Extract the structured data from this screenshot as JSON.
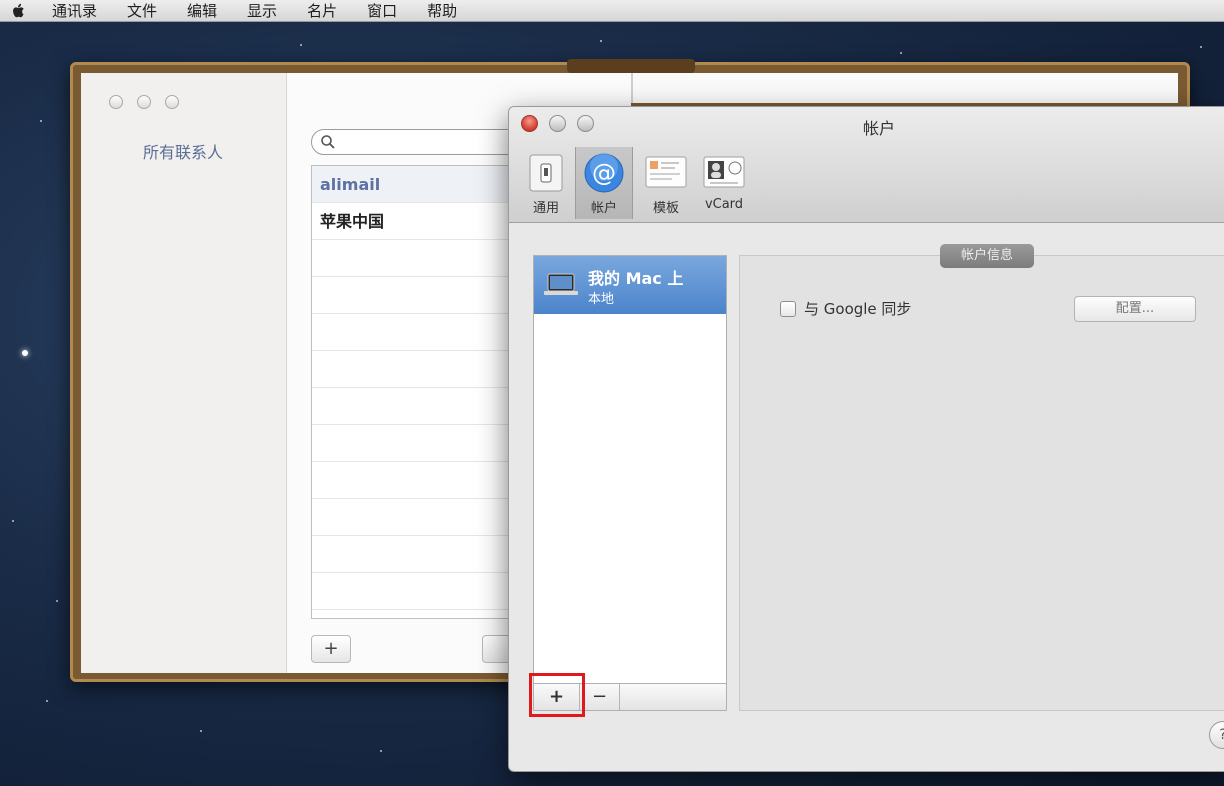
{
  "menubar": {
    "items": [
      "通讯录",
      "文件",
      "编辑",
      "显示",
      "名片",
      "窗口",
      "帮助"
    ]
  },
  "book": {
    "group_label": "所有联系人",
    "contacts": [
      "alimail",
      "苹果中国"
    ]
  },
  "prefs": {
    "title": "帐户",
    "toolbar": [
      {
        "label": "通用",
        "icon": "general-icon"
      },
      {
        "label": "帐户",
        "icon": "at-sign-icon"
      },
      {
        "label": "模板",
        "icon": "template-icon"
      },
      {
        "label": "vCard",
        "icon": "vcard-icon"
      }
    ],
    "accounts": [
      {
        "name": "我的 Mac 上",
        "sub": "本地"
      }
    ],
    "buttons": {
      "add": "+",
      "remove": "−"
    },
    "info": {
      "tab_label": "帐户信息",
      "sync_label": "与 Google 同步",
      "config_button": "配置..."
    },
    "help": "?"
  },
  "colors": {
    "selection": "#4b84cc",
    "highlight": "#e0191d",
    "close_button": "#d23a2c"
  }
}
